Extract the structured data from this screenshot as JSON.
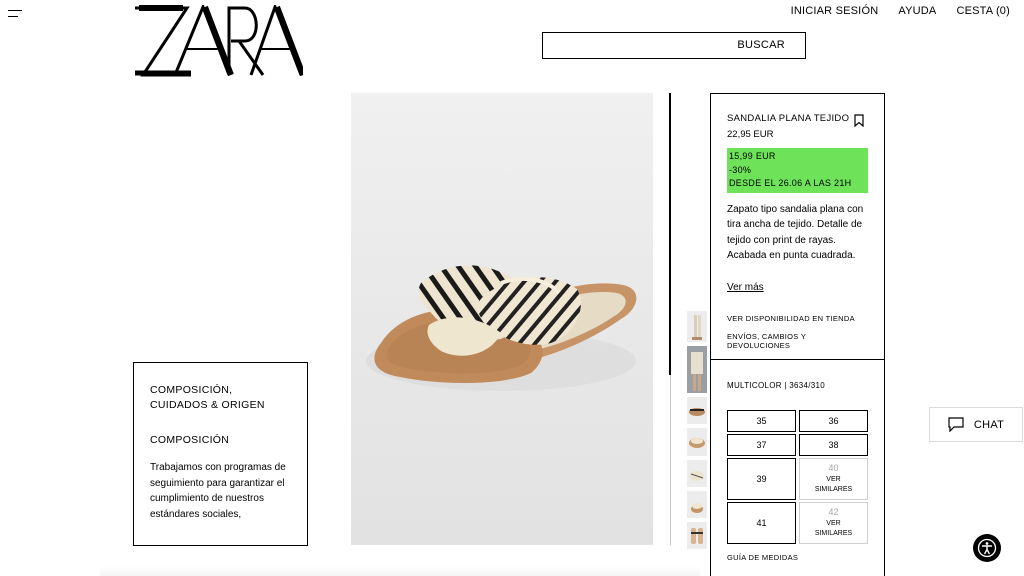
{
  "header": {
    "logo_text": "ZARA",
    "nav": [
      "INICIAR SESIÓN",
      "AYUDA",
      "CESTA (0)"
    ],
    "search": {
      "value": "",
      "placeholder": "",
      "button_label": "BUSCAR"
    }
  },
  "info_card": {
    "heading_line1": "COMPOSICIÓN,",
    "heading_line2": "CUIDADOS & ORIGEN",
    "subheading": "COMPOSICIÓN",
    "body": "Trabajamos con programas de seguimiento para garantizar el cumplimiento de nuestros estándares sociales, medioambientales"
  },
  "product": {
    "name": "SANDALIA PLANA TEJIDO",
    "original_price": "22,95 EUR",
    "promo": {
      "price": "15,99 EUR",
      "discount": "-30%",
      "validity": "DESDE EL 26.06 A LAS 21H",
      "color": "#6ee35a"
    },
    "description": "Zapato tipo sandalia plana con tira ancha de tejido. Detalle de tejido con print de rayas. Acabada en punta cuadrada.",
    "see_more": "Ver más",
    "store_availability": "VER DISPONIBILIDAD EN TIENDA",
    "shipping_returns": "ENVÍOS, CAMBIOS Y DEVOLUCIONES",
    "color_ref": "MULTICOLOR | 3634/310",
    "sizes": [
      {
        "size": "35",
        "available": true
      },
      {
        "size": "36",
        "available": true
      },
      {
        "size": "37",
        "available": true
      },
      {
        "size": "38",
        "available": true
      },
      {
        "size": "39",
        "available": true
      },
      {
        "size": "40",
        "available": false,
        "note_line1": "VER",
        "note_line2": "SIMILARES"
      },
      {
        "size": "41",
        "available": true
      },
      {
        "size": "42",
        "available": false,
        "note_line1": "VER",
        "note_line2": "SIMILARES"
      }
    ],
    "size_guide": "GUÍA DE MEDIDAS"
  },
  "gallery": {
    "thumbnails": [
      "model-legs",
      "model-outfit",
      "sandal-top",
      "sandal-pair",
      "sandal-detail",
      "sandal-side",
      "sandal-front"
    ]
  },
  "widgets": {
    "chat_label": "CHAT",
    "chat_icon": "speech-bubble-icon",
    "accessibility_icon": "accessibility-icon"
  }
}
